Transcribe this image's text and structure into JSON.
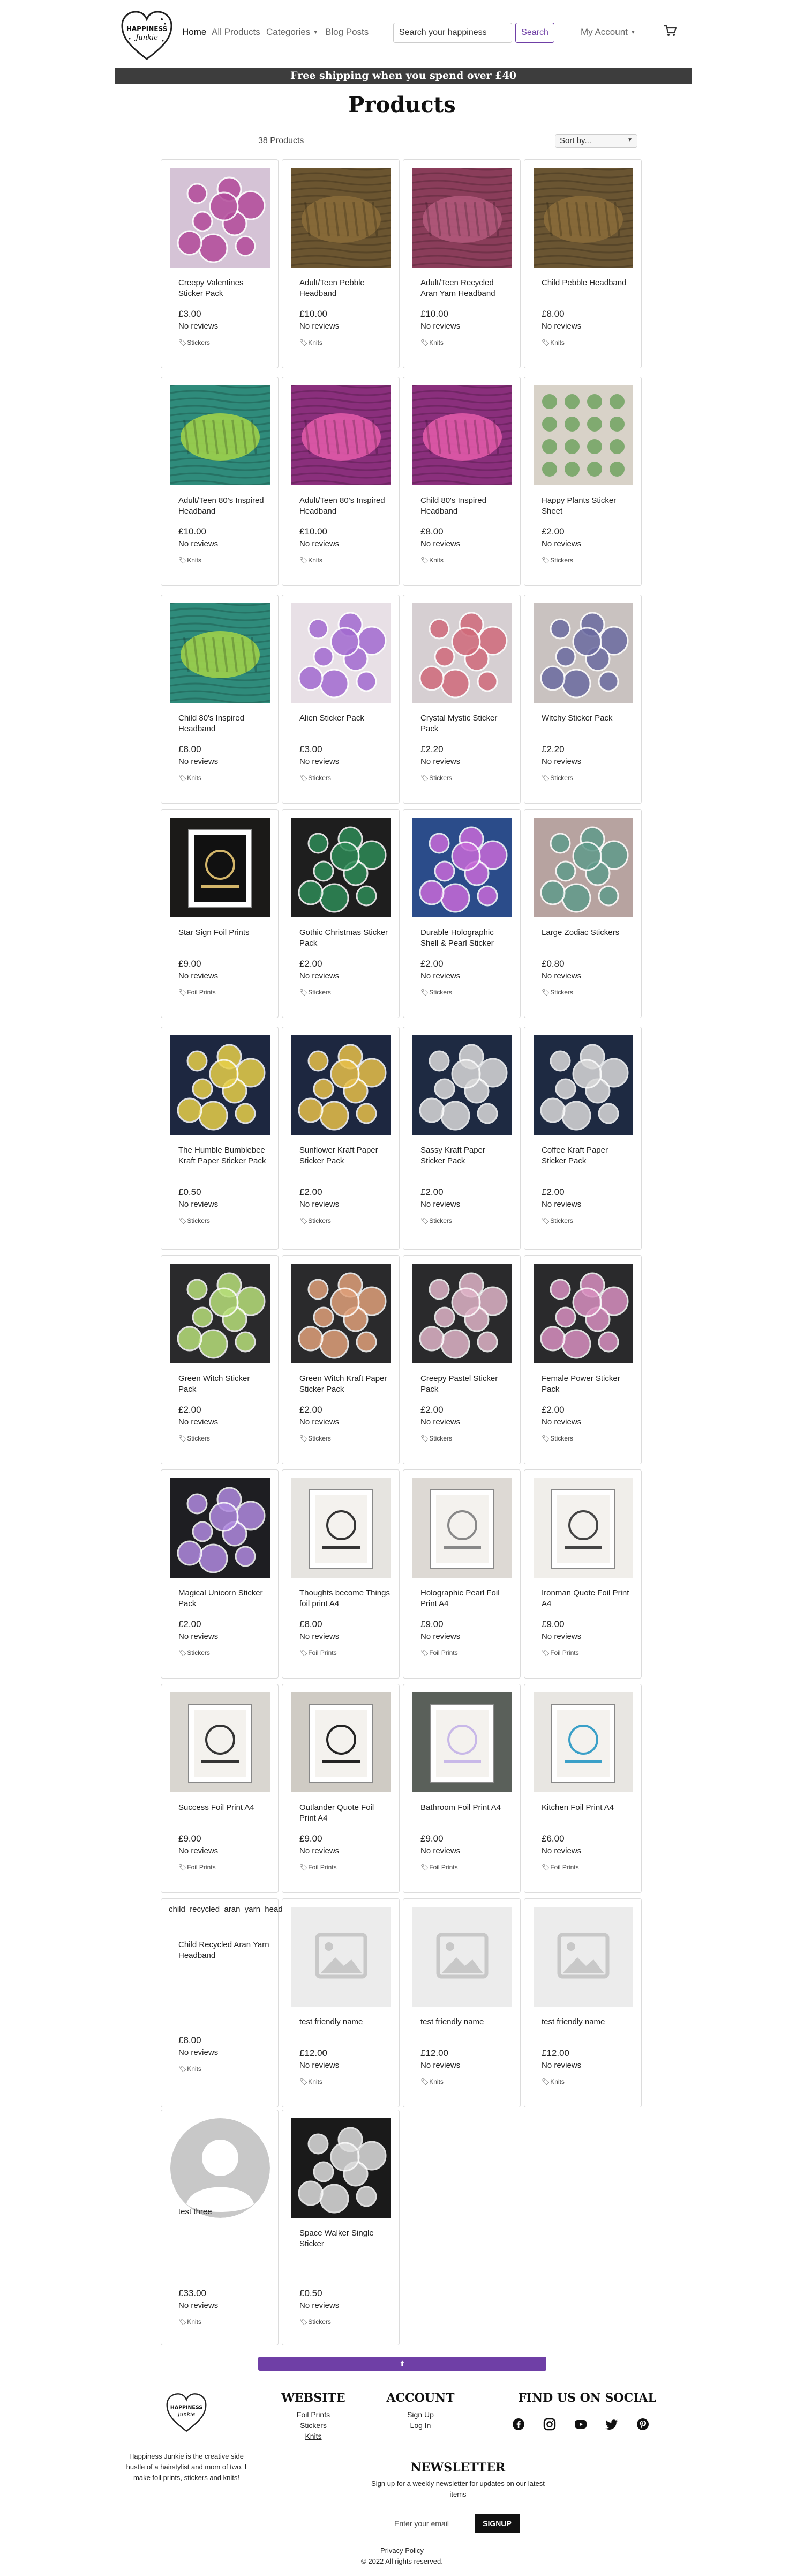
{
  "header": {
    "logo_text": [
      "HAPPINESS",
      "Junkie"
    ],
    "nav": [
      {
        "label": "Home"
      },
      {
        "label": "All Products"
      },
      {
        "label": "Categories"
      },
      {
        "label": "Blog Posts"
      }
    ],
    "search": {
      "placeholder": "Search your happiness"
    },
    "search_button": "Search",
    "account_label": "My Account",
    "cart_icon": "cart-icon"
  },
  "banner": "Free shipping when you spend over £40",
  "page_title": "Products",
  "product_count": "38 Products",
  "sort": {
    "selected": "Sort by..."
  },
  "products": [
    {
      "name": "Creepy Valentines Sticker Pack",
      "price": "£3.00",
      "reviews": "No reviews",
      "category": "Stickers"
    },
    {
      "name": "Adult/Teen Pebble Headband",
      "price": "£10.00",
      "reviews": "No reviews",
      "category": "Knits"
    },
    {
      "name": "Adult/Teen Recycled Aran Yarn Headband",
      "price": "£10.00",
      "reviews": "No reviews",
      "category": "Knits"
    },
    {
      "name": "Child Pebble Headband",
      "price": "£8.00",
      "reviews": "No reviews",
      "category": "Knits"
    },
    {
      "name": "Adult/Teen 80's Inspired Headband",
      "price": "£10.00",
      "reviews": "No reviews",
      "category": "Knits"
    },
    {
      "name": "Adult/Teen 80's Inspired Headband",
      "price": "£10.00",
      "reviews": "No reviews",
      "category": "Knits"
    },
    {
      "name": "Child 80's Inspired Headband",
      "price": "£8.00",
      "reviews": "No reviews",
      "category": "Knits"
    },
    {
      "name": "Happy Plants Sticker Sheet",
      "price": "£2.00",
      "reviews": "No reviews",
      "category": "Stickers"
    },
    {
      "name": "Child 80's Inspired Headband",
      "price": "£8.00",
      "reviews": "No reviews",
      "category": "Knits"
    },
    {
      "name": "Alien Sticker Pack",
      "price": "£3.00",
      "reviews": "No reviews",
      "category": "Stickers"
    },
    {
      "name": "Crystal Mystic Sticker Pack",
      "price": "£2.20",
      "reviews": "No reviews",
      "category": "Stickers"
    },
    {
      "name": "Witchy Sticker Pack",
      "price": "£2.20",
      "reviews": "No reviews",
      "category": "Stickers"
    },
    {
      "name": "Star Sign Foil Prints",
      "price": "£9.00",
      "reviews": "No reviews",
      "category": "Foil Prints"
    },
    {
      "name": "Gothic Christmas Sticker Pack",
      "price": "£2.00",
      "reviews": "No reviews",
      "category": "Stickers"
    },
    {
      "name": "Durable Holographic Shell & Pearl Sticker",
      "price": "£2.00",
      "reviews": "No reviews",
      "category": "Stickers"
    },
    {
      "name": "Large Zodiac Stickers",
      "price": "£0.80",
      "reviews": "No reviews",
      "category": "Stickers"
    },
    {
      "name": "The Humble Bumblebee Kraft Paper Sticker Pack",
      "price": "£0.50",
      "reviews": "No reviews",
      "category": "Stickers"
    },
    {
      "name": "Sunflower Kraft Paper Sticker Pack",
      "price": "£2.00",
      "reviews": "No reviews",
      "category": "Stickers"
    },
    {
      "name": "Sassy Kraft Paper Sticker Pack",
      "price": "£2.00",
      "reviews": "No reviews",
      "category": "Stickers"
    },
    {
      "name": "Coffee Kraft Paper Sticker Pack",
      "price": "£2.00",
      "reviews": "No reviews",
      "category": "Stickers"
    },
    {
      "name": "Green Witch Sticker Pack",
      "price": "£2.00",
      "reviews": "No reviews",
      "category": "Stickers"
    },
    {
      "name": "Green Witch Kraft Paper Sticker Pack",
      "price": "£2.00",
      "reviews": "No reviews",
      "category": "Stickers"
    },
    {
      "name": "Creepy Pastel Sticker Pack",
      "price": "£2.00",
      "reviews": "No reviews",
      "category": "Stickers"
    },
    {
      "name": "Female Power Sticker Pack",
      "price": "£2.00",
      "reviews": "No reviews",
      "category": "Stickers"
    },
    {
      "name": "Magical Unicorn Sticker Pack",
      "price": "£2.00",
      "reviews": "No reviews",
      "category": "Stickers"
    },
    {
      "name": "Thoughts become Things foil print A4",
      "price": "£8.00",
      "reviews": "No reviews",
      "category": "Foil Prints"
    },
    {
      "name": "Holographic Pearl Foil Print A4",
      "price": "£9.00",
      "reviews": "No reviews",
      "category": "Foil Prints"
    },
    {
      "name": "Ironman Quote Foil Print A4",
      "price": "£9.00",
      "reviews": "No reviews",
      "category": "Foil Prints"
    },
    {
      "name": "Success Foil Print A4",
      "price": "£9.00",
      "reviews": "No reviews",
      "category": "Foil Prints"
    },
    {
      "name": "Outlander Quote Foil Print A4",
      "price": "£9.00",
      "reviews": "No reviews",
      "category": "Foil Prints"
    },
    {
      "name": "Bathroom Foil Print A4",
      "price": "£9.00",
      "reviews": "No reviews",
      "category": "Foil Prints"
    },
    {
      "name": "Kitchen Foil Print A4",
      "price": "£6.00",
      "reviews": "No reviews",
      "category": "Foil Prints"
    },
    {
      "name": "Child Recycled Aran Yarn Headband",
      "price": "£8.00",
      "reviews": "No reviews",
      "category": "Knits",
      "image_alt": "child_recycled_aran_yarn_headband"
    },
    {
      "name": "test friendly name",
      "price": "£12.00",
      "reviews": "No reviews",
      "category": "Knits"
    },
    {
      "name": "test friendly name",
      "price": "£12.00",
      "reviews": "No reviews",
      "category": "Knits"
    },
    {
      "name": "test friendly name",
      "price": "£12.00",
      "reviews": "No reviews",
      "category": "Knits"
    },
    {
      "name": "test three",
      "price": "£33.00",
      "reviews": "No reviews",
      "category": "Knits"
    },
    {
      "name": "Space Walker Single Sticker",
      "price": "£0.50",
      "reviews": "No reviews",
      "category": "Stickers"
    }
  ],
  "back_to_top": "⬆",
  "footer": {
    "about": "Happiness Junkie is the creative side hustle of a hairstylist and mom of two. I make foil prints, stickers and knits!",
    "website": {
      "heading": "WEBSITE",
      "links": [
        "Foil Prints",
        "Stickers",
        "Knits"
      ]
    },
    "account": {
      "heading": "ACCOUNT",
      "links": [
        "Sign Up",
        "Log In"
      ]
    },
    "social": {
      "heading": "FIND US ON SOCIAL",
      "icons": [
        "facebook-icon",
        "instagram-icon",
        "youtube-icon",
        "twitter-icon",
        "pinterest-icon"
      ]
    },
    "newsletter": {
      "heading": "NEWSLETTER",
      "description": "Sign up for a weekly newsletter for updates on our latest items",
      "email_placeholder": "Enter your email",
      "button": "SIGNUP"
    },
    "privacy": "Privacy Policy",
    "copyright": "© 2022 All rights reserved."
  },
  "colors": {
    "accent": "#6f3fa6",
    "banner": "#3d3d3d",
    "footer_bg": "#ffffff"
  }
}
